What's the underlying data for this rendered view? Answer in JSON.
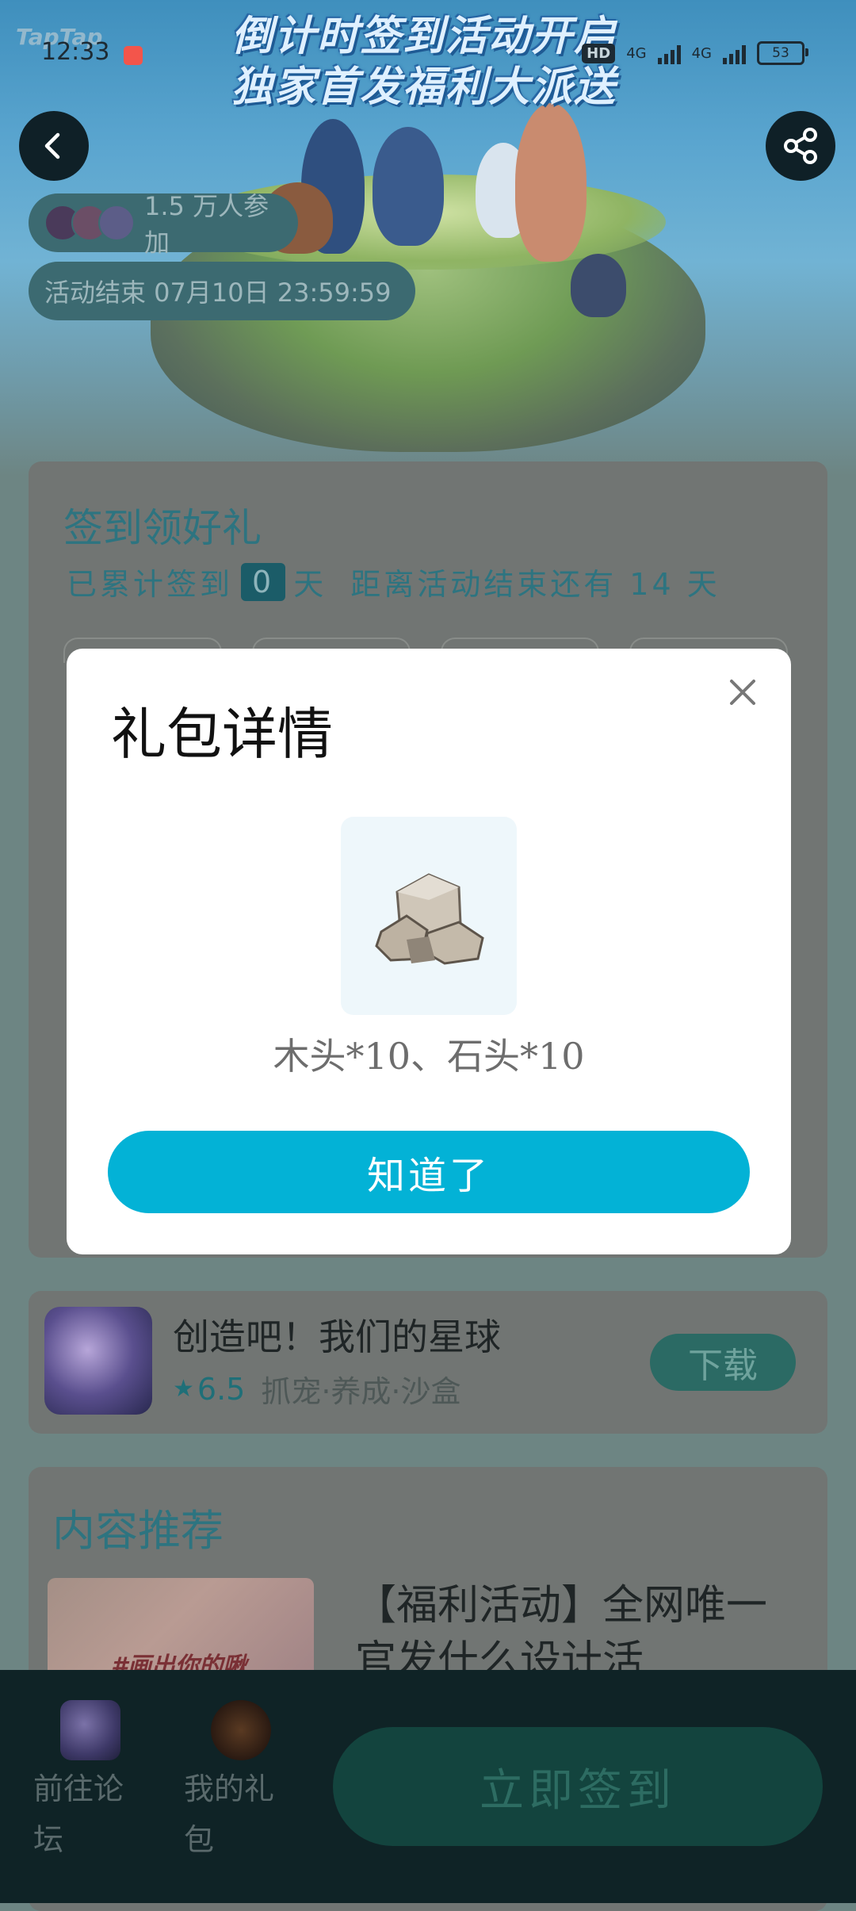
{
  "status_bar": {
    "time": "12:33",
    "network_1": "4G",
    "network_2": "4G",
    "hd": "HD",
    "battery": "53"
  },
  "banner": {
    "logo": "TapTap",
    "title_line1": "倒计时签到活动开启",
    "title_line2": "独家首发福利大派送"
  },
  "header": {
    "participants": "1.5 万人参加",
    "end_time": "活动结束 07月10日 23:59:59"
  },
  "checkin_card": {
    "title": "签到领好礼",
    "accumulated_prefix": "已累计签到",
    "accumulated_days": "0",
    "accumulated_suffix": "天",
    "remaining_text": "距离活动结束还有 14 天"
  },
  "game": {
    "name": "创造吧！我们的星球",
    "rating": "6.5",
    "tags": "抓宠·养成·沙盒",
    "download_label": "下载"
  },
  "content": {
    "title": "内容推荐",
    "thumb_text": "#画出你的啾",
    "article_title": "【福利活动】全网唯一官发什么设计活"
  },
  "bottom_bar": {
    "forum_label": "前往论坛",
    "gift_label": "我的礼包",
    "checkin_label": "立即签到"
  },
  "modal": {
    "title": "礼包详情",
    "description": "木头*10、石头*10",
    "ok_label": "知道了"
  },
  "colors": {
    "accent": "#03b2d6",
    "overlay": "#6d8583"
  }
}
